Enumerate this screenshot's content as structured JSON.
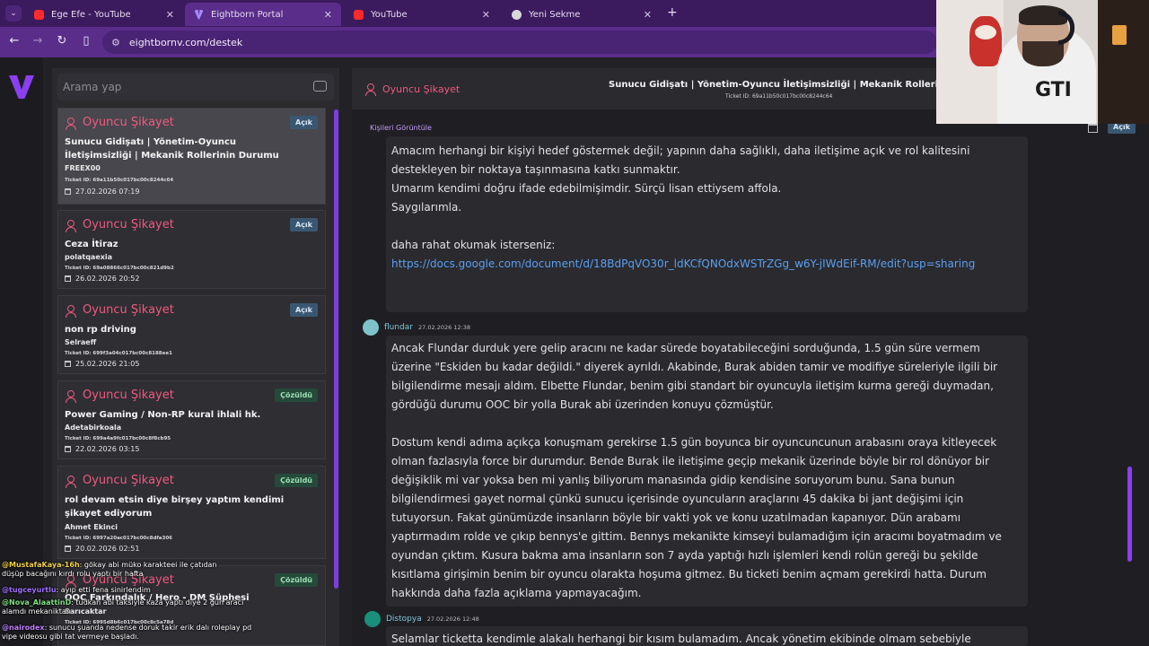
{
  "browser": {
    "tabs": [
      {
        "title": "Ege Efe - YouTube",
        "icon": "youtube-icon"
      },
      {
        "title": "Eightborn Portal",
        "icon": "eightborn-icon"
      },
      {
        "title": "YouTube",
        "icon": "youtube-icon"
      },
      {
        "title": "Yeni Sekme",
        "icon": "chrome-icon"
      }
    ],
    "url": "eightbornv.com/destek"
  },
  "sidebar": {
    "search_placeholder": "Arama yap"
  },
  "tickets": [
    {
      "category": "Oyuncu Şikayet",
      "status": "Açık",
      "subject": "Sunucu Gidişatı | Yönetim-Oyuncu İletişimsizliği | Mekanik Rollerinin Durumu",
      "user": "FREEX00",
      "ticket_id": "Ticket ID: 69a11b50c017bc00c8244c64",
      "date": "27.02.2026 07:19"
    },
    {
      "category": "Oyuncu Şikayet",
      "status": "Açık",
      "subject": "Ceza İtiraz",
      "user": "polatqaexia",
      "ticket_id": "Ticket ID: 69a08866c017bc00c821d9b2",
      "date": "26.02.2026 20:52"
    },
    {
      "category": "Oyuncu Şikayet",
      "status": "Açık",
      "subject": "non rp driving",
      "user": "Selraeff",
      "ticket_id": "Ticket ID: 699f3a04c017bc00c8188ee1",
      "date": "25.02.2026 21:05"
    },
    {
      "category": "Oyuncu Şikayet",
      "status": "Çözüldü",
      "subject": "Power Gaming / Non-RP kural ihlali hk.",
      "user": "Adetabirkoala",
      "ticket_id": "Ticket ID: 699a4a9fc017bc00c8f8cb95",
      "date": "22.02.2026 03:15"
    },
    {
      "category": "Oyuncu Şikayet",
      "status": "Çözüldü",
      "subject": "rol devam etsin diye birşey yaptım kendimi şikayet ediyorum",
      "user": "Ahmet Ekinci",
      "ticket_id": "Ticket ID: 6997a20ac017bc00c8dfa306",
      "date": "20.02.2026 02:51"
    },
    {
      "category": "Oyuncu Şikayet",
      "status": "Çözüldü",
      "subject": "OOC Farkındalık / Hero - DM Şüphesi",
      "user": "Sarıcaktar",
      "ticket_id": "Ticket ID: 6995d8b6c017bc00c8c5a78d",
      "date": ""
    }
  ],
  "chat": [
    {
      "nick": "@MustafaKaya-16h",
      "text": ": gökay abi müko karakteei ile çatıdan düşüp bacağını kırdı rolu yaptı bir hafta",
      "color": "#f0d04a"
    },
    {
      "nick": "@tugceyurtlu",
      "text": ": ayıp etti fena sinirlendim",
      "color": "#a070ff"
    },
    {
      "nick": "@Nova_AlaattinD",
      "text": ": tudkan abi taksiyle kaza yaptı diye 2 gün aracı alamdı mekaniktan",
      "color": "#7fe07f"
    },
    {
      "nick": "@nairodex",
      "text": ": sunucu şuanda nedense doruk takir erik dalı roleplay pd vipe videosu gibi tat vermeye başladı.",
      "color": "#c080ff"
    }
  ],
  "ticket_view": {
    "category": "Oyuncu Şikayet",
    "title": "Sunucu Gidişatı | Yönetim-Oyuncu İletişimsizliği | Mekanik Rollerinin Durumu",
    "ticket_id": "Ticket ID: 69a11b50c017bc00c8244c64",
    "view_people": "Kişileri Görüntüle",
    "status": "Açık"
  },
  "messages": [
    {
      "paragraphs": [
        "Amacım herhangi bir kişiyi hedef göstermek değil; yapının daha sağlıklı, daha iletişime açık ve rol kalitesini destekleyen bir noktaya taşınmasına katkı sunmaktır.",
        "Umarım kendimi doğru ifade edebilmişimdir. Sürçü lisan ettiysem affola.",
        "Saygılarımla.",
        "",
        "daha rahat okumak isterseniz:"
      ],
      "link": "https://docs.google.com/document/d/18BdPqVO30r_ldKCfQNOdxWSTrZGg_w6Y-jIWdEif-RM/edit?usp=sharing"
    },
    {
      "author": "flundar",
      "time": "27.02.2026 12:38",
      "text1": " Ancak Flundar durduk yere gelip aracını ne kadar sürede boyatabileceğini sorduğunda, 1.5 gün süre vermem üzerine \"Eskiden bu kadar değildi.\" diyerek ayrıldı. Akabinde, Burak abiden tamir ve modifiye süreleriyle ilgili bir bilgilendirme mesajı aldım. Elbette Flundar, benim gibi standart bir oyuncuyla iletişim kurma gereği duymadan, gördüğü durumu OOC bir yolla Burak abi üzerinden konuyu çözmüştür.",
      "text2": "Dostum kendi adıma açıkça konuşmam gerekirse 1.5 gün boyunca bir oyuncuncunun arabasını oraya kitleyecek olman fazlasıyla force bir durumdur. Bende Burak ile iletişime geçip mekanik üzerinde böyle bir rol dönüyor bir değişiklik mi var yoksa ben mi yanlış biliyorum manasında gidip kendisine soruyorum bunu. Sana bunun bilgilendirmesi gayet normal çünkü sunucu içerisinde oyuncuların araçlarını 45 dakika bi jant değişimi için tutuyorsun. Fakat günümüzde insanların böyle bir vakti yok ve konu uzatılmadan kapanıyor. Dün arabamı yaptırmadım rolde ve çıkıp bennys'e gittim. Bennys mekanikte kimseyi bulamadığım için aracımı boyatmadım ve oyundan çıktım. Kusura bakma ama insanların son 7 ayda yaptığı hızlı işlemleri kendi rolün gereği bu şekilde kısıtlama girişimin benim bir oyuncu olarakta hoşuma gitmez. Bu ticketi benim açmam gerekirdi hatta. Durum hakkında daha fazla açıklama yapmayacağım."
    },
    {
      "author": "Distopya",
      "time": "27.02.2026 12:48",
      "text1": "Selamlar ticketta kendimle alakalı herhangi bir kısım bulamadım. Ancak yönetim ekibinde olmam sebebiyle"
    }
  ]
}
